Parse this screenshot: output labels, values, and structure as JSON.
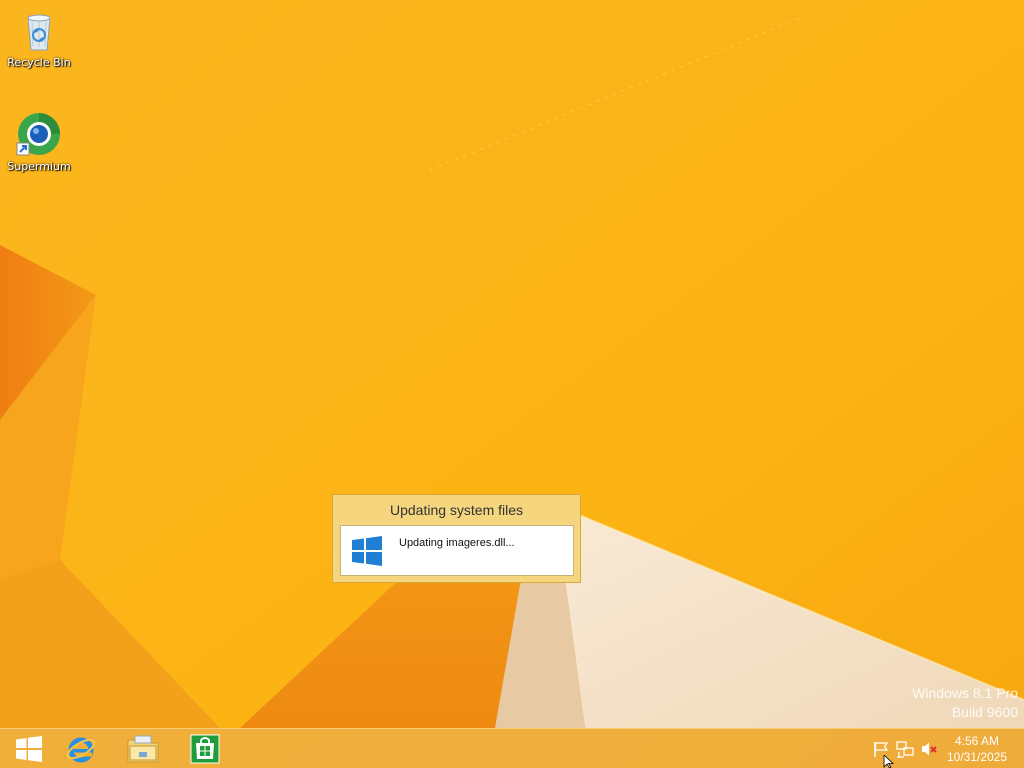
{
  "desktop": {
    "icons": [
      {
        "label": "Recycle Bin",
        "icon": "recycle-bin-icon"
      },
      {
        "label": "Supermium",
        "icon": "supermium-browser-icon"
      }
    ],
    "watermark": {
      "line1": "Windows 8.1 Pro",
      "line2": "Build 9600"
    }
  },
  "dialog": {
    "title": "Updating system files",
    "status": "Updating imageres.dll...",
    "icon": "windows-logo-icon"
  },
  "taskbar": {
    "buttons": [
      {
        "name": "start",
        "icon": "windows-start-icon"
      },
      {
        "name": "internet-explorer",
        "icon": "internet-explorer-icon"
      },
      {
        "name": "file-explorer",
        "icon": "folder-icon"
      },
      {
        "name": "store",
        "icon": "store-icon"
      }
    ],
    "tray": {
      "icons": [
        "action-center-flag-icon",
        "network-icon",
        "volume-muted-icon"
      ],
      "time": "4:56 AM",
      "date": "10/31/2025"
    }
  },
  "colors": {
    "wallpaper_base": "#fbb218",
    "wallpaper_orange": "#f08a14",
    "wallpaper_cream": "#f6e3c8",
    "windows_blue": "#1f7fd4",
    "store_green": "#1e9e3a"
  }
}
